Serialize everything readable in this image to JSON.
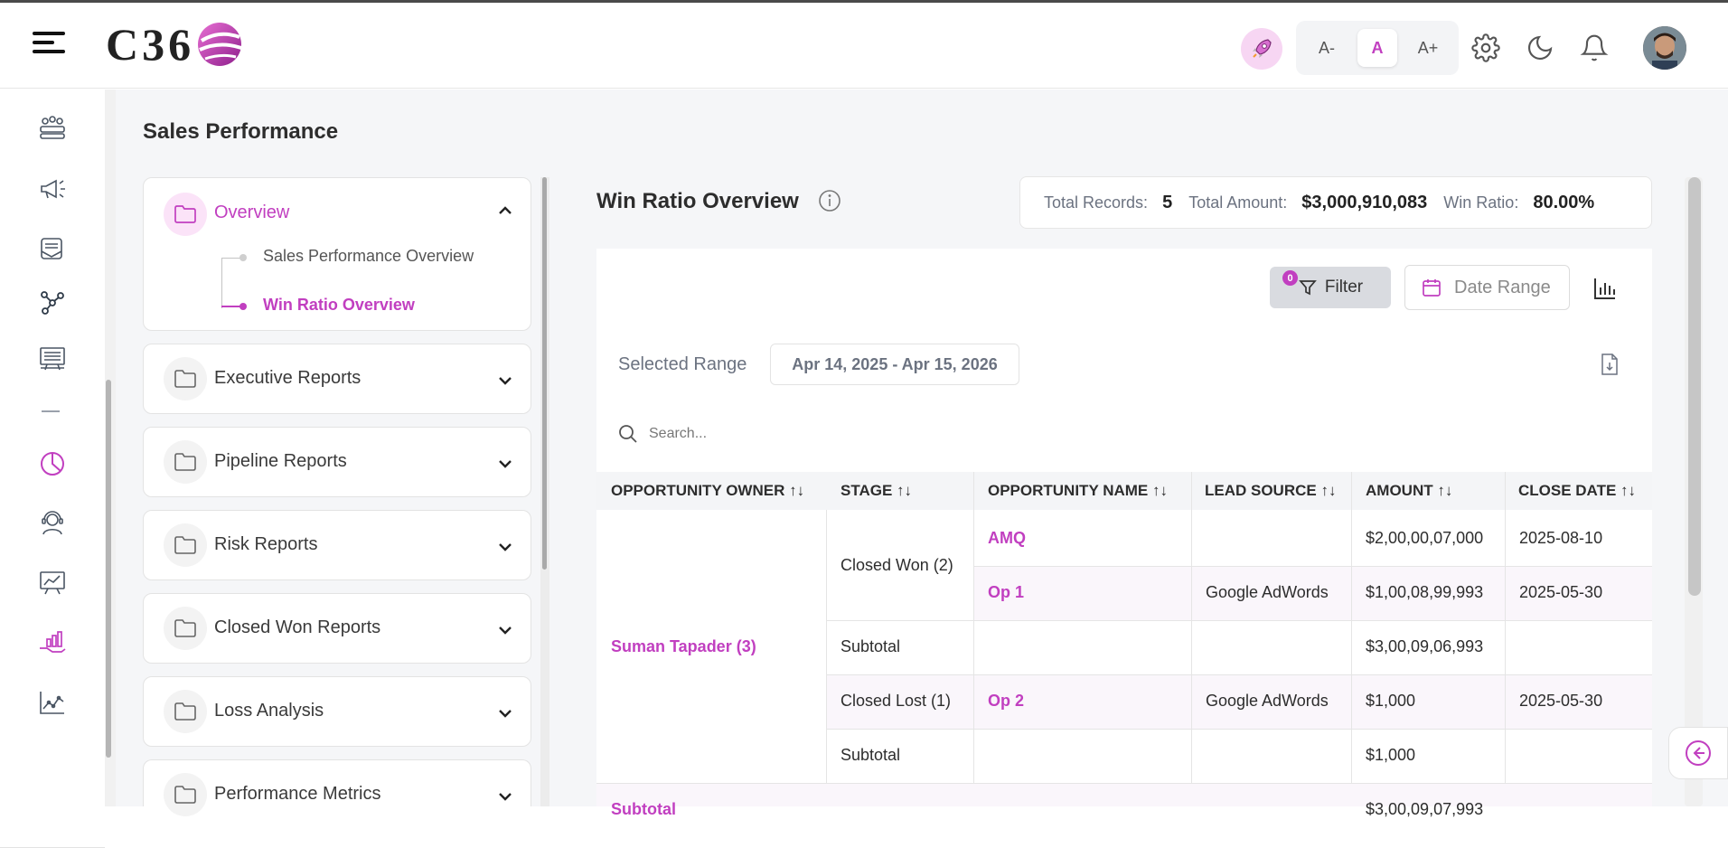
{
  "brand": {
    "logo_text": "C36"
  },
  "header": {
    "font_decrease": "A-",
    "font_default": "A",
    "font_increase": "A+"
  },
  "page": {
    "title": "Sales Performance"
  },
  "reports": {
    "overview": {
      "label": "Overview",
      "items": [
        "Sales Performance Overview",
        "Win Ratio Overview"
      ],
      "active_item": "Win Ratio Overview"
    },
    "folders": [
      "Executive Reports",
      "Pipeline Reports",
      "Risk Reports",
      "Closed Won Reports",
      "Loss Analysis",
      "Performance Metrics"
    ]
  },
  "content": {
    "title": "Win Ratio Overview",
    "stats": {
      "total_records_label": "Total Records:",
      "total_records_value": "5",
      "total_amount_label": "Total Amount:",
      "total_amount_value": "$3,000,910,083",
      "win_ratio_label": "Win Ratio:",
      "win_ratio_value": "80.00%"
    },
    "filter": {
      "label": "Filter",
      "badge": "0"
    },
    "date_range_label": "Date Range",
    "selected_range_label": "Selected Range",
    "selected_range_value": "Apr 14, 2025 - Apr 15, 2026",
    "search_placeholder": "Search..."
  },
  "table": {
    "columns": [
      "OPPORTUNITY OWNER ↑↓",
      "STAGE ↑↓",
      "OPPORTUNITY NAME ↑↓",
      "LEAD SOURCE ↑↓",
      "AMOUNT ↑↓",
      "CLOSE DATE ↑↓"
    ],
    "owner": "Suman Tapader (3)",
    "stage_won": "Closed Won (2)",
    "stage_lost": "Closed Lost (1)",
    "subtotal_label": "Subtotal",
    "row1": {
      "name": "AMQ",
      "lead": "",
      "amount": "$2,00,00,07,000",
      "date": "2025-08-10"
    },
    "row2": {
      "name": "Op 1",
      "lead": "Google AdWords",
      "amount": "$1,00,08,99,993",
      "date": "2025-05-30"
    },
    "subtotal_won_amount": "$3,00,09,06,993",
    "row3": {
      "name": "Op 2",
      "lead": "Google AdWords",
      "amount": "$1,000",
      "date": "2025-05-30"
    },
    "subtotal_lost_amount": "$1,000",
    "owner_subtotal_label": "Subtotal",
    "owner_subtotal_amount": "$3,00,09,07,993"
  },
  "colors": {
    "accent": "#c13fc0",
    "accent_light": "#fbe3f8",
    "bg": "#f5f6f8"
  }
}
